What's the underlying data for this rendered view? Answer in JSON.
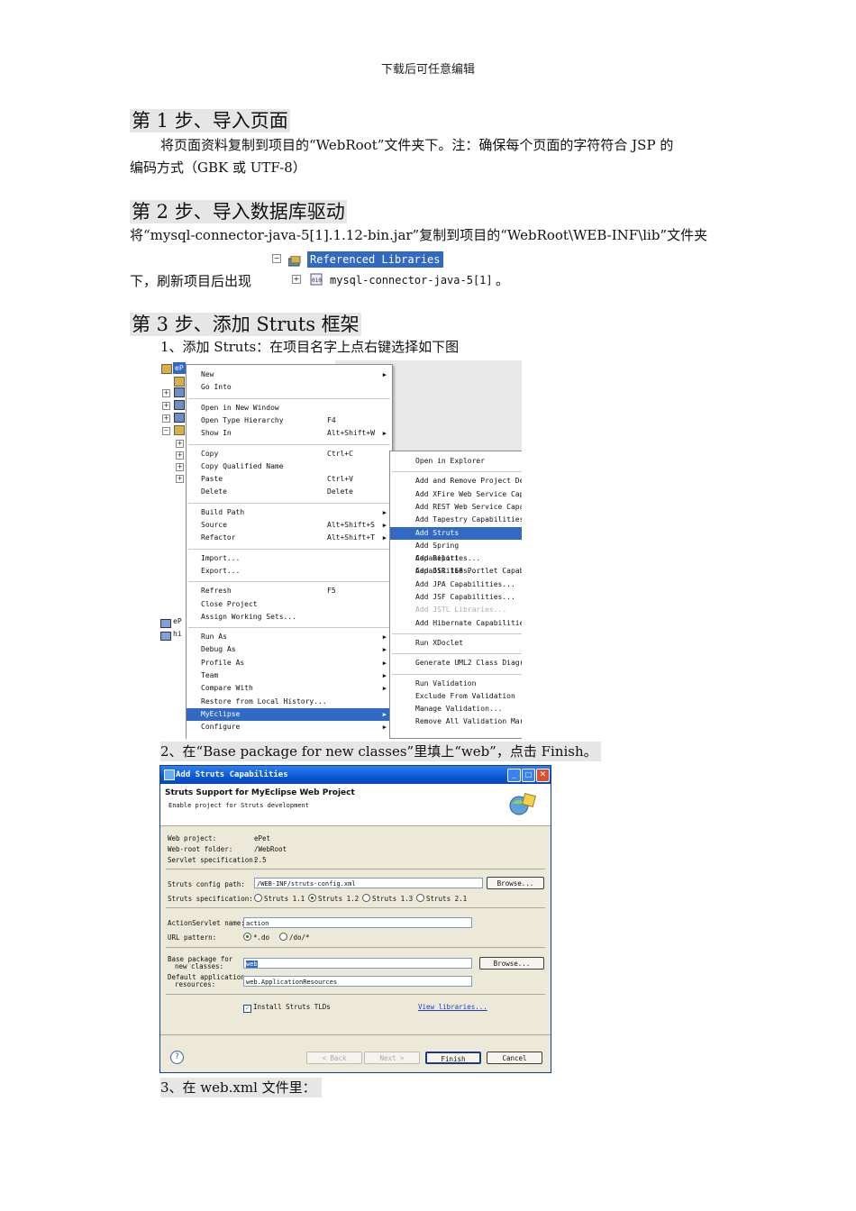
{
  "header": "下载后可任意编辑",
  "step1": {
    "title": "第 1 步、导入页面",
    "line1": "将页面资料复制到项目的“WebRoot”文件夹下。注：确保每个页面的字符符合 JSP 的",
    "line2": "编码方式（GBK 或 UTF-8）"
  },
  "step2": {
    "title": "第 2 步、导入数据库驱动",
    "line1": "将“mysql-connector-java-5[1].1.12-bin.jar”复制到项目的“WebRoot\\WEB-INF\\lib”文件夹",
    "line2": "下，刷新项目后出现",
    "tree_ref": "Referenced Libraries",
    "tree_jar": "mysql-connector-java-5[1]",
    "tree_tail": "。"
  },
  "step3": {
    "title": "第 3 步、添加 Struts 框架",
    "item1": "1、添加 Struts：在项目名字上点右键选择如下图",
    "item2": "2、在“Base package for new classes”里填上“web”，点击 Finish。",
    "item3": "3、在 web.xml 文件里："
  },
  "explorer": {
    "project_short": "eP",
    "side_items": [
      "eP",
      "hi"
    ]
  },
  "context_menu": [
    {
      "label": "New",
      "shortcut": "",
      "arrow": true
    },
    {
      "label": "Go Into",
      "shortcut": ""
    },
    {
      "sep": true
    },
    {
      "label": "Open in New Window",
      "shortcut": ""
    },
    {
      "label": "Open Type Hierarchy",
      "shortcut": "F4"
    },
    {
      "label": "Show In",
      "shortcut": "Alt+Shift+W",
      "arrow": true
    },
    {
      "sep": true
    },
    {
      "label": "Copy",
      "shortcut": "Ctrl+C"
    },
    {
      "label": "Copy Qualified Name",
      "shortcut": ""
    },
    {
      "label": "Paste",
      "shortcut": "Ctrl+V"
    },
    {
      "label": "Delete",
      "shortcut": "Delete"
    },
    {
      "sep": true
    },
    {
      "label": "Build Path",
      "shortcut": "",
      "arrow": true
    },
    {
      "label": "Source",
      "shortcut": "Alt+Shift+S",
      "arrow": true
    },
    {
      "label": "Refactor",
      "shortcut": "Alt+Shift+T",
      "arrow": true
    },
    {
      "sep": true
    },
    {
      "label": "Import...",
      "shortcut": ""
    },
    {
      "label": "Export...",
      "shortcut": ""
    },
    {
      "sep": true
    },
    {
      "label": "Refresh",
      "shortcut": "F5"
    },
    {
      "label": "Close Project",
      "shortcut": ""
    },
    {
      "label": "Assign Working Sets...",
      "shortcut": ""
    },
    {
      "sep": true
    },
    {
      "label": "Run As",
      "shortcut": "",
      "arrow": true
    },
    {
      "label": "Debug As",
      "shortcut": "",
      "arrow": true
    },
    {
      "label": "Profile As",
      "shortcut": "",
      "arrow": true
    },
    {
      "label": "Team",
      "shortcut": "",
      "arrow": true
    },
    {
      "label": "Compare With",
      "shortcut": "",
      "arrow": true
    },
    {
      "label": "Restore from Local History...",
      "shortcut": ""
    },
    {
      "label": "MyEclipse",
      "shortcut": "",
      "arrow": true,
      "selected": true
    },
    {
      "label": "Configure",
      "shortcut": "",
      "arrow": true
    }
  ],
  "submenu": [
    {
      "label": "Open in Explorer"
    },
    {
      "sep": true
    },
    {
      "label": "Add and Remove Project De"
    },
    {
      "label": "Add XFire Web Service Cap"
    },
    {
      "label": "Add REST Web Service Capa"
    },
    {
      "label": "Add Tapestry Capabilities"
    },
    {
      "label": "Add Struts Capabilities...",
      "selected": true
    },
    {
      "label": "Add Spring Capabilities..."
    },
    {
      "label": "Add Report Capabilities..."
    },
    {
      "label": "Add JSR 168 Portlet Capab"
    },
    {
      "label": "Add JPA Capabilities..."
    },
    {
      "label": "Add JSF Capabilities..."
    },
    {
      "label": "Add JSTL Libraries...",
      "disabled": true
    },
    {
      "label": "Add Hibernate Capabilitie"
    },
    {
      "sep": true
    },
    {
      "label": "Run XDoclet"
    },
    {
      "sep": true
    },
    {
      "label": "Generate UML2 Class Diagr"
    },
    {
      "sep": true
    },
    {
      "label": "Run Validation"
    },
    {
      "label": "Exclude From Validation"
    },
    {
      "label": "Manage Validation..."
    },
    {
      "label": "Remove All Validation Mar"
    }
  ],
  "dialog": {
    "title": "Add Struts Capabilities",
    "heading": "Struts Support for MyEclipse Web Project",
    "subheading": "Enable project for Struts development",
    "web_project_label": "Web project:",
    "web_project_value": "ePet",
    "web_root_label": "Web-root folder:",
    "web_root_value": "/WebRoot",
    "servlet_label": "Servlet specification:",
    "servlet_value": "2.5",
    "config_label": "Struts config path:",
    "config_value": "/WEB-INF/struts-config.xml",
    "browse": "Browse...",
    "spec_label": "Struts specification:",
    "spec_options": [
      "Struts 1.1",
      "Struts 1.2",
      "Struts 1.3",
      "Struts 2.1"
    ],
    "spec_selected": "Struts 1.2",
    "action_label": "ActionServlet name:",
    "action_value": "action",
    "url_label": "URL pattern:",
    "url_options": [
      "*.do",
      "/do/*"
    ],
    "url_selected": "*.do",
    "base_label_1": "Base package for",
    "base_label_2": "new classes:",
    "base_value": "web",
    "default_label_1": "Default application",
    "default_label_2": "resources:",
    "default_value": "web.ApplicationResources",
    "install_tlds": "Install Struts TLDs",
    "view_libraries": "View libraries...",
    "back": "< Back",
    "next": "Next >",
    "finish": "Finish",
    "cancel": "Cancel",
    "help": "?"
  },
  "colors": {
    "selection": "#316ac5",
    "xp_title": "#0a58d8",
    "dialog_bg": "#ece9d8",
    "heading_bg": "#e6e6e6"
  }
}
